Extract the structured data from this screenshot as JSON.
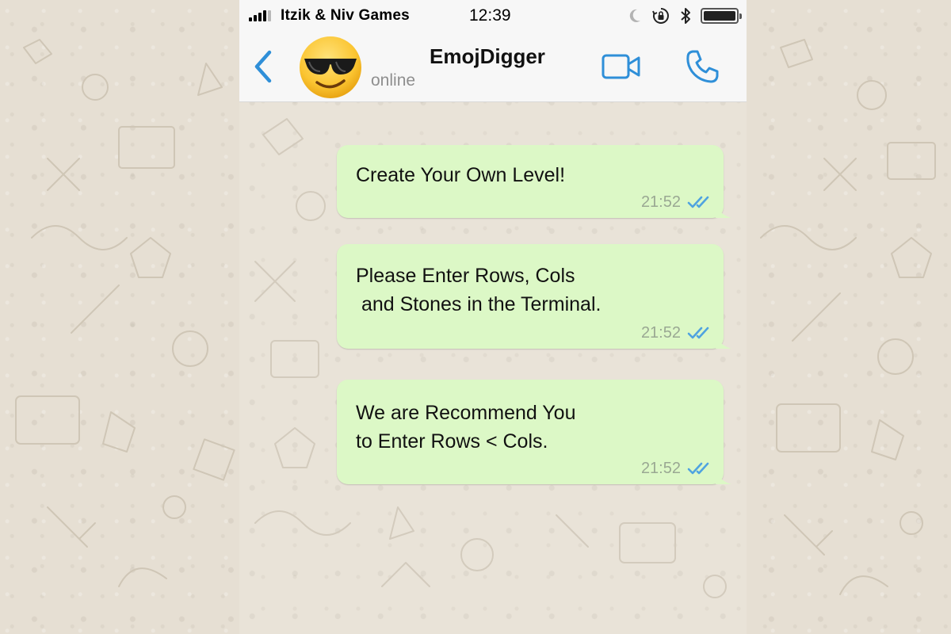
{
  "status_bar": {
    "carrier": "Itzik & Niv Games",
    "time": "12:39",
    "icons": [
      "signal-icon",
      "moon-icon",
      "rotation-lock-icon",
      "bluetooth-icon",
      "battery-icon"
    ],
    "battery_level": 1.0
  },
  "header": {
    "back_icon": "chevron-left-icon",
    "avatar_emoji": "😎",
    "contact_name": "EmojDigger",
    "contact_status": "online",
    "video_icon": "video-camera-icon",
    "call_icon": "phone-icon"
  },
  "messages": [
    {
      "text": "Create Your Own Level!",
      "time": "21:52",
      "status_icon": "double-check-icon"
    },
    {
      "text": "Please Enter Rows, Cols\n and Stones in the Terminal.",
      "time": "21:52",
      "status_icon": "double-check-icon"
    },
    {
      "text": "We are Recommend You\nto Enter Rows < Cols.",
      "time": "21:52",
      "status_icon": "double-check-icon"
    }
  ],
  "colors": {
    "accent": "#2f8fd8",
    "bubble_outgoing": "#dcf8c6",
    "read_ticks": "#4fa3e0",
    "wallpaper": "#e6dfd3"
  }
}
